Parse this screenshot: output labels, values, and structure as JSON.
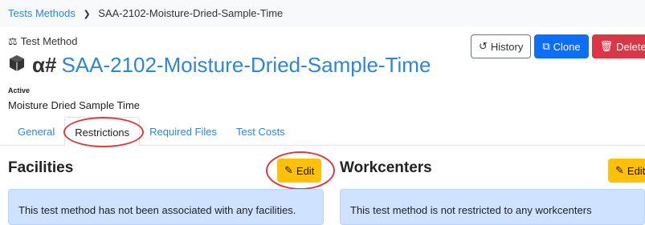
{
  "breadcrumb": {
    "parent": "Tests Methods",
    "current": "SAA-2102-Moisture-Dried-Sample-Time"
  },
  "header": {
    "kind_label": "Test Method",
    "prefix_symbol": "α#",
    "title": "SAA-2102-Moisture-Dried-Sample-Time",
    "status": "Active",
    "description": "Moisture Dried Sample Time"
  },
  "actions": {
    "history": "History",
    "clone": "Clone",
    "delete": "Delete"
  },
  "tabs": [
    {
      "label": "General"
    },
    {
      "label": "Restrictions"
    },
    {
      "label": "Required Files"
    },
    {
      "label": "Test Costs"
    }
  ],
  "facilities": {
    "title": "Facilities",
    "edit": "Edit",
    "message": "This test method has not been associated with any facilities."
  },
  "workcenters": {
    "title": "Workcenters",
    "edit": "Edit",
    "message": "This test method is not restricted to any workcenters"
  },
  "colors": {
    "link": "#2f86d6",
    "primary": "#0d6efd",
    "danger": "#dc3545",
    "warning": "#ffc107",
    "info_bg": "#cfe2ff",
    "annotation": "#e0383e"
  }
}
